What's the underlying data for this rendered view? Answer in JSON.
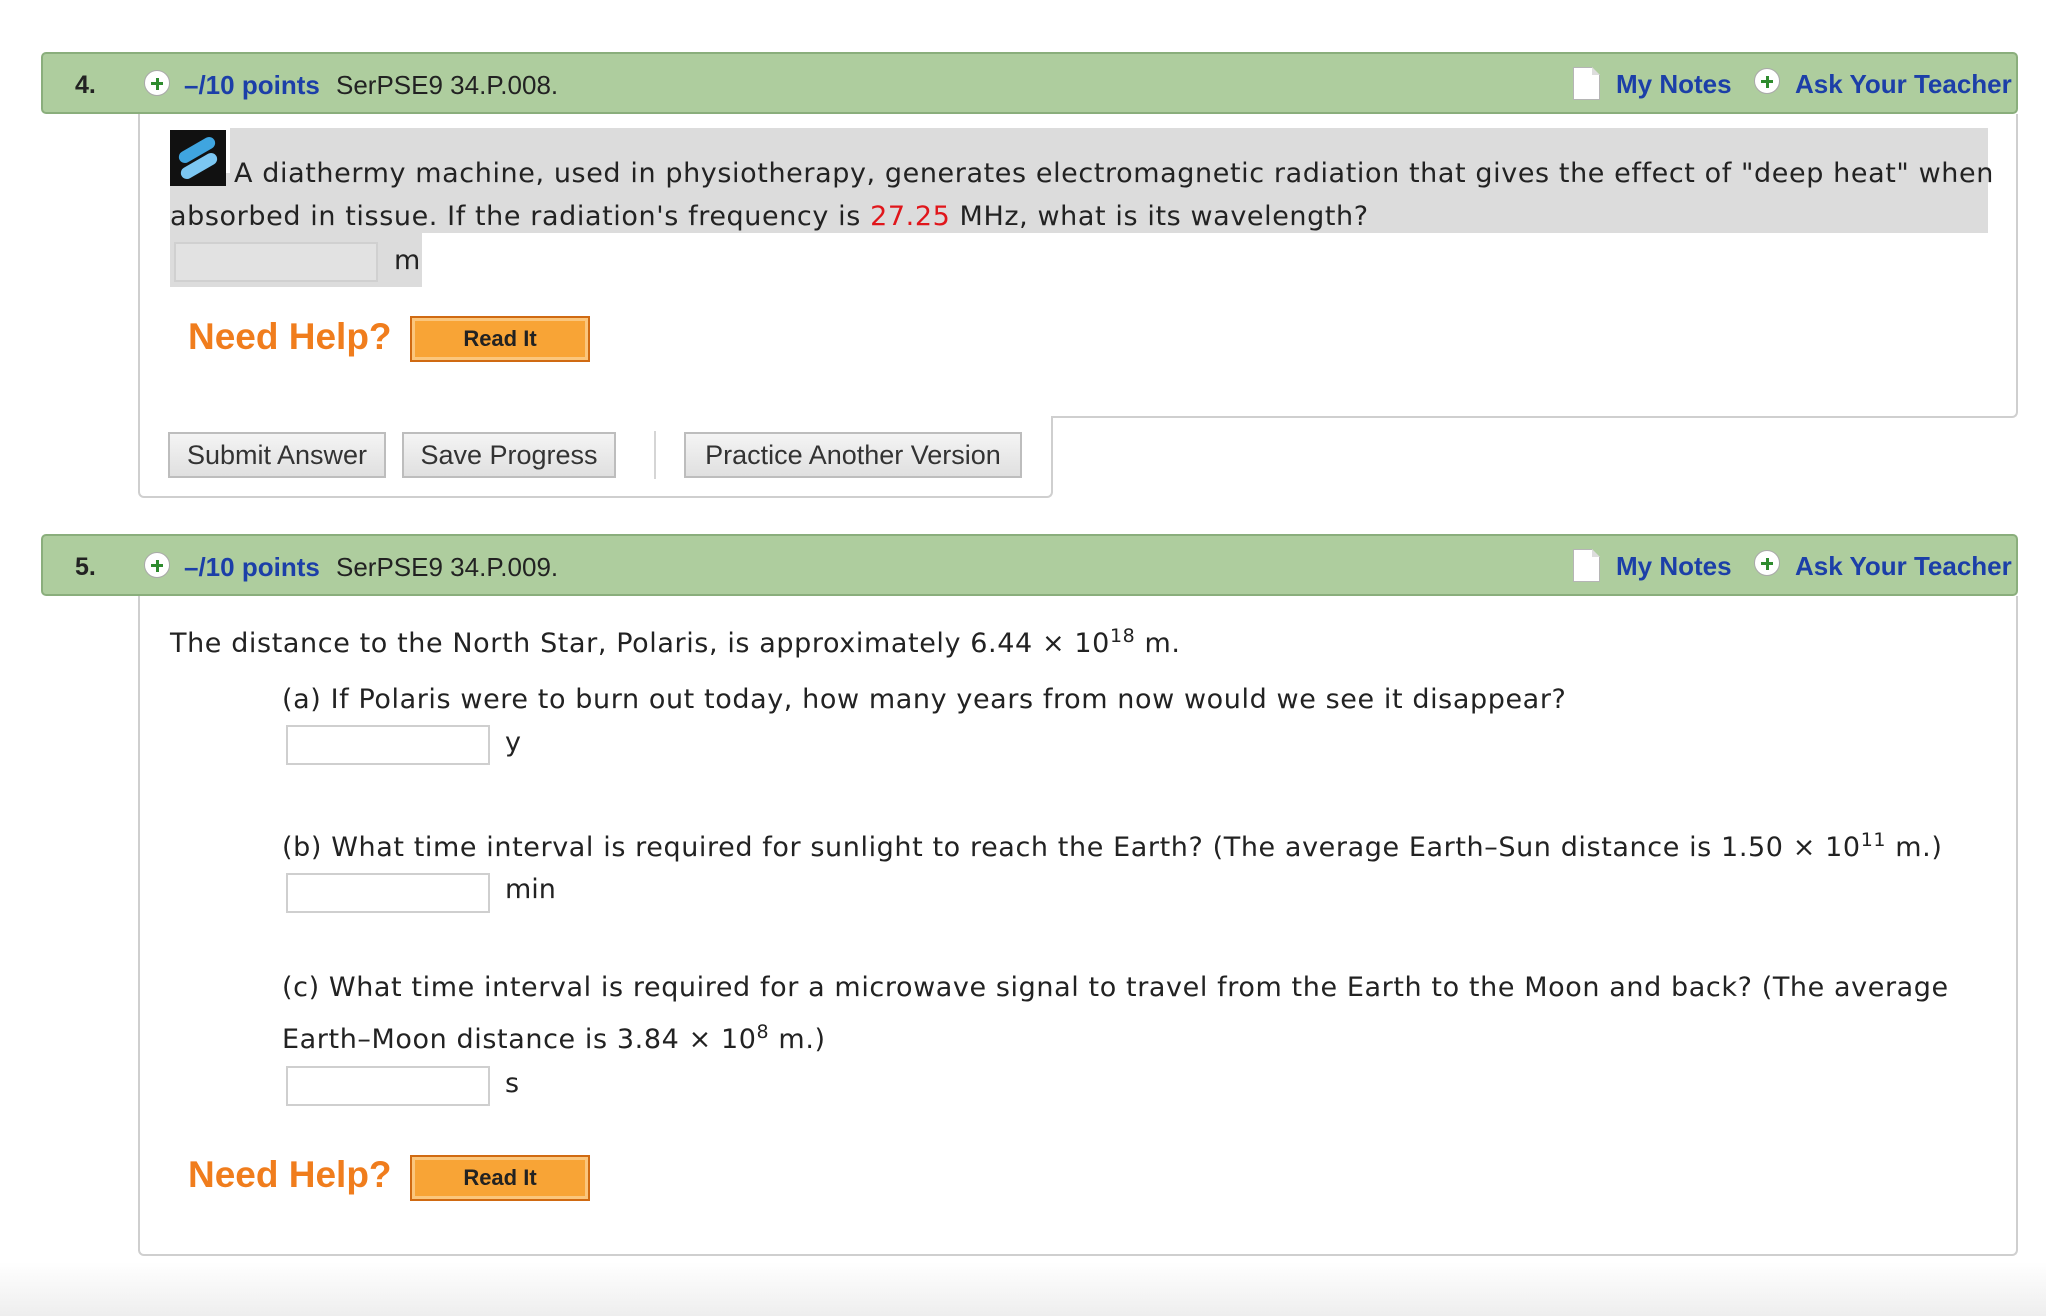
{
  "q4": {
    "number": "4.",
    "points": "–/10 points",
    "code": "SerPSE9 34.P.008.",
    "my_notes": "My Notes",
    "ask_teacher": "Ask Your Teacher",
    "text_before": "A diathermy machine, used in physiotherapy, generates electromagnetic radiation that gives the effect of \"deep heat\" when",
    "text_line2_a": "absorbed in tissue. If the radiation's frequency is ",
    "frequency": "27.25",
    "text_line2_b": " MHz, what is its wavelength?",
    "unit": "m",
    "answer": "",
    "need_help": "Need Help?",
    "read_it": "Read It",
    "submit": "Submit Answer",
    "save": "Save Progress",
    "practice": "Practice Another Version"
  },
  "q5": {
    "number": "5.",
    "points": "–/10 points",
    "code": "SerPSE9 34.P.009.",
    "my_notes": "My Notes",
    "ask_teacher": "Ask Your Teacher",
    "intro_a": "The distance to the North Star, Polaris, is approximately 6.44 × 10",
    "intro_exp": "18",
    "intro_b": " m.",
    "part_a": "(a) If Polaris were to burn out today, how many years from now would we see it disappear?",
    "unit_a": "y",
    "part_b_a": "(b) What time interval is required for sunlight to reach the Earth? (The average Earth–Sun distance is 1.50 × 10",
    "part_b_exp": "11",
    "part_b_b": " m.)",
    "unit_b": "min",
    "part_c_line1": "(c) What time interval is required for a microwave signal to travel from the Earth to the Moon and back? (The average",
    "part_c_a": "Earth–Moon distance is 3.84 × 10",
    "part_c_exp": "8",
    "part_c_b": " m.)",
    "unit_c": "s",
    "need_help": "Need Help?",
    "read_it": "Read It"
  }
}
